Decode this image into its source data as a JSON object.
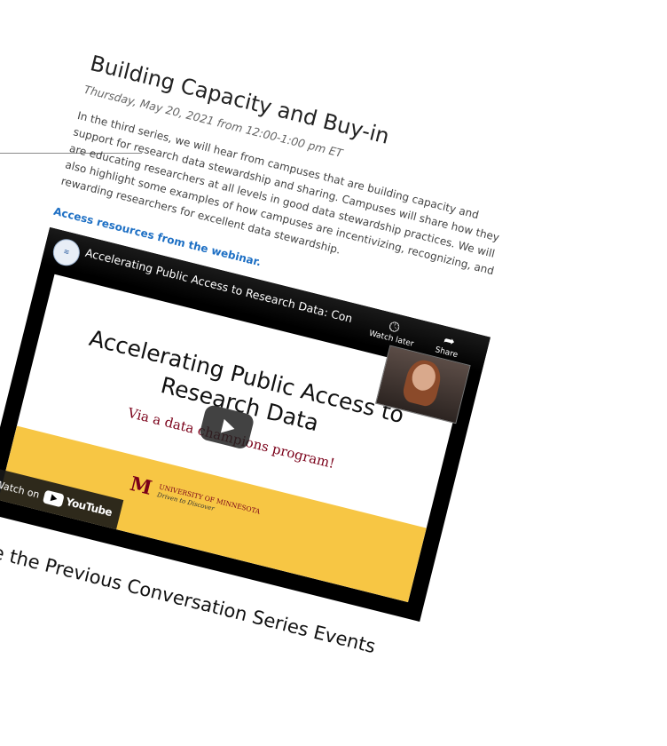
{
  "event": {
    "title": "Building Capacity and Buy-in",
    "date": "Thursday, May 20, 2021 from 12:00-1:00 pm ET",
    "description": "In the third series, we will hear from campuses that are building capacity and support for research data stewardship and sharing. Campuses will share how they are educating researchers at all levels in good data stewardship practices. We will also highlight some examples of how campuses are incentivizing, recognizing, and rewarding researchers for excellent data stewardship.",
    "resources_link": "Access resources from the webinar."
  },
  "video": {
    "title": "Accelerating Public Access to Research Data: Conver",
    "watch_later_label": "Watch later",
    "share_label": "Share",
    "watch_on_label": "Watch on",
    "youtube_label": "YouTube",
    "slide": {
      "title": "Accelerating Public Access to Research Data",
      "subtitle": "Via a data champions program!",
      "university_name": "UNIVERSITY OF MINNESOTA",
      "university_tagline": "Driven to Discover"
    }
  },
  "footer": {
    "previous_heading": "See the Previous Conversation Series Events"
  }
}
